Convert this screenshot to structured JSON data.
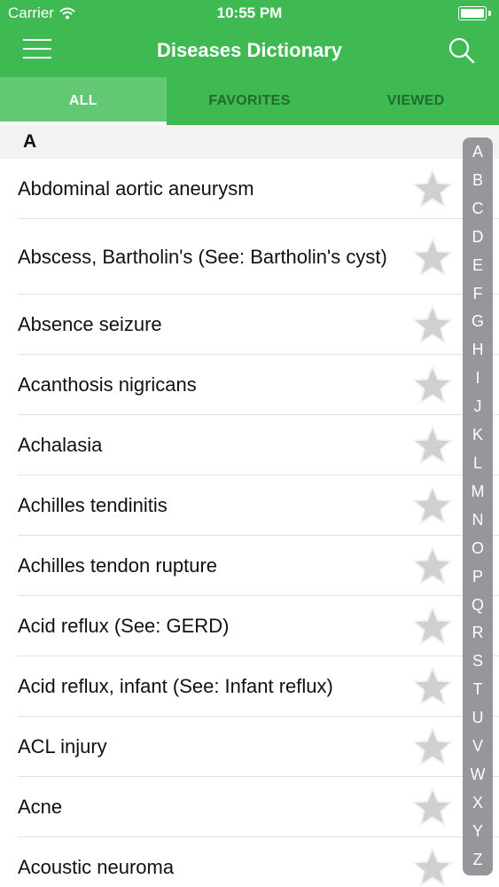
{
  "status_bar": {
    "carrier": "Carrier",
    "time": "10:55 PM"
  },
  "nav": {
    "title": "Diseases Dictionary",
    "menu_icon": "hamburger-menu-icon",
    "search_icon": "search-icon"
  },
  "tabs": [
    {
      "label": "ALL",
      "active": true
    },
    {
      "label": "FAVORITES",
      "active": false
    },
    {
      "label": "VIEWED",
      "active": false
    }
  ],
  "section": {
    "letter": "A"
  },
  "items": [
    {
      "label": "Abdominal aortic aneurysm"
    },
    {
      "label": "Abscess, Bartholin's (See: Bartholin's cyst)"
    },
    {
      "label": "Absence seizure"
    },
    {
      "label": "Acanthosis nigricans"
    },
    {
      "label": "Achalasia"
    },
    {
      "label": "Achilles tendinitis"
    },
    {
      "label": "Achilles tendon rupture"
    },
    {
      "label": "Acid reflux (See: GERD)"
    },
    {
      "label": "Acid reflux, infant (See: Infant reflux)"
    },
    {
      "label": "ACL injury"
    },
    {
      "label": "Acne"
    },
    {
      "label": "Acoustic neuroma"
    }
  ],
  "index_letters": [
    "A",
    "B",
    "C",
    "D",
    "E",
    "F",
    "G",
    "H",
    "I",
    "J",
    "K",
    "L",
    "M",
    "N",
    "O",
    "P",
    "Q",
    "R",
    "S",
    "T",
    "U",
    "V",
    "W",
    "X",
    "Y",
    "Z"
  ],
  "colors": {
    "accent": "#3fba52",
    "active_tab": "#63c873",
    "inactive_tab_text": "#226b2e",
    "star_fill": "#d0d0d0",
    "index_bar": "#8e8e93"
  }
}
